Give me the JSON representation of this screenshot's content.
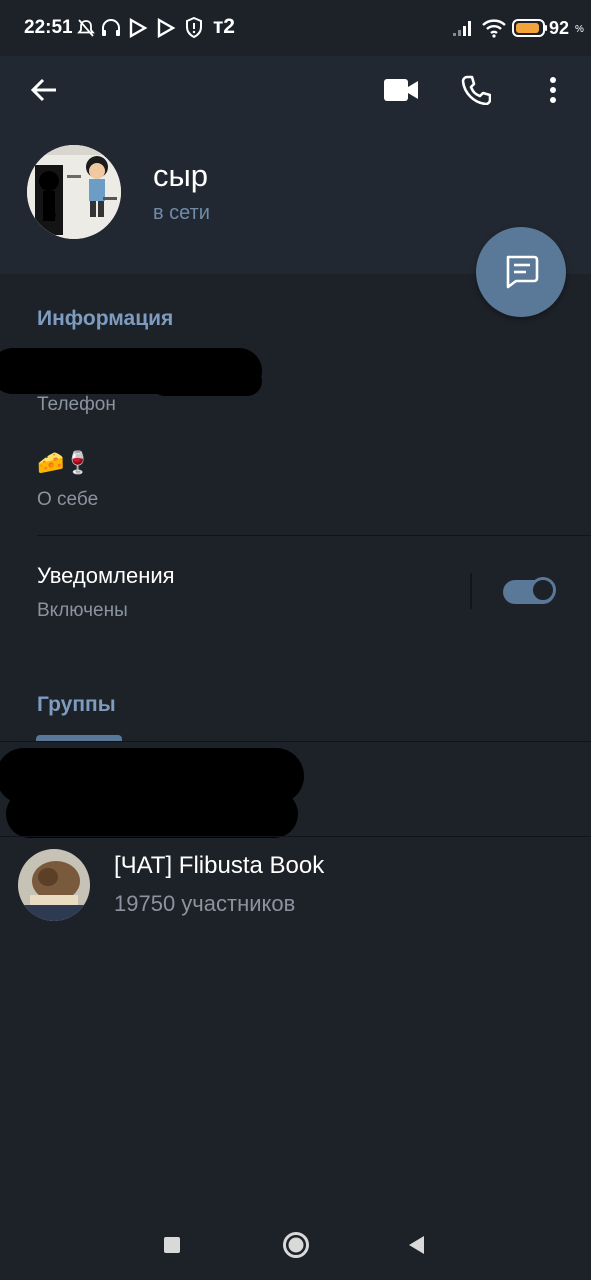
{
  "status_bar": {
    "time": "22:51",
    "carrier": "т2",
    "battery_percent": "92",
    "battery_unit": "%",
    "battery_level": 0.92,
    "icons": [
      "mute-icon",
      "headset-icon",
      "play-icon",
      "play-icon",
      "shield-icon",
      "signal-icon",
      "wifi-icon",
      "battery-icon"
    ]
  },
  "header": {
    "back_icon": "arrow-left-icon",
    "video_call_icon": "video-camera-icon",
    "call_icon": "phone-icon",
    "more_icon": "more-vertical-icon"
  },
  "profile": {
    "name": "сыр",
    "status": "в сети"
  },
  "fab": {
    "icon": "message-icon"
  },
  "info": {
    "section_title": "Информация",
    "phone_label": "Телефон",
    "bio_value": "🧀🍷",
    "bio_label": "О себе"
  },
  "notifications": {
    "title": "Уведомления",
    "state": "Включены",
    "enabled": true
  },
  "groups": {
    "section_title": "Группы",
    "items": [
      {
        "name": "[ЧАТ] Flibusta Book",
        "members": "19750 участников"
      }
    ]
  },
  "colors": {
    "background": "#1d2128",
    "header": "#222831",
    "accent": "#5a7897",
    "section_title": "#7d9cbf",
    "status_online": "#6f8ba8",
    "secondary_text": "#8b949e"
  },
  "nav_bar": {
    "icons": [
      "square-icon",
      "home-circle-icon",
      "back-triangle-icon"
    ]
  }
}
